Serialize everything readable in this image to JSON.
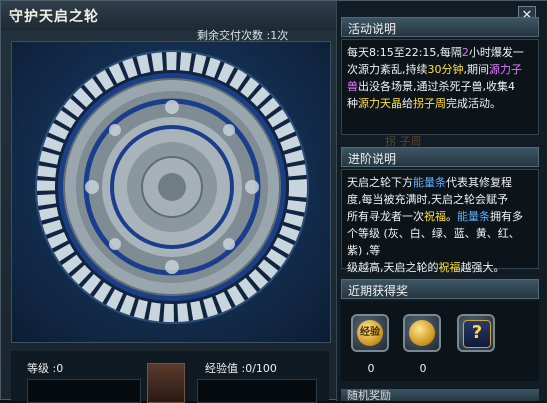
{
  "window": {
    "title": "守护天启之轮",
    "delivery_remaining": "剩余交付次数 :1次"
  },
  "wheel": {
    "level_label": "等级 :0",
    "exp_label": "经验值 :0/100",
    "colors": {
      "outer_ring": "#c9d6de",
      "inner_ring": "#1b3e8c",
      "disc": "#9aa6ae"
    }
  },
  "panel": {
    "close": "✕",
    "activity": {
      "header": "活动说明",
      "lines": [
        [
          "每天",
          "8:15",
          "至",
          "22:15",
          ",每隔",
          "2",
          "小时爆发一"
        ],
        [
          "次源力紊乱,持续",
          "30分钟",
          ",期间",
          "源力子"
        ],
        [
          "兽",
          "出没各场景,通过杀死子兽,收集",
          "4"
        ],
        [
          "种",
          "源力天晶",
          "给",
          "拐子周",
          "完成活动。"
        ]
      ]
    },
    "watermark": "拐 子周",
    "advance": {
      "header": "进阶说明",
      "lines": [
        [
          "天启之轮下方",
          "能量条",
          "代表其修复程"
        ],
        [
          "度,每当被充满时,天启之轮会赋予"
        ],
        [
          "所有寻龙者一次",
          "祝福",
          "。",
          "能量条",
          "拥有多"
        ],
        [
          "个等级 (灰、白、绿、蓝、黄、红、紫) ,等"
        ],
        [
          "级越高,天启之轮的",
          "祝福",
          "越强大。"
        ]
      ]
    },
    "recent_header": "近期获得奖",
    "rewards": [
      {
        "icon": "exp-scroll-icon",
        "label": "经验",
        "count": "0"
      },
      {
        "icon": "coin-icon",
        "label": "",
        "count": "0"
      },
      {
        "icon": "mystery-box-icon",
        "label": "?",
        "count": ""
      }
    ],
    "next_header": "随机奖励"
  }
}
